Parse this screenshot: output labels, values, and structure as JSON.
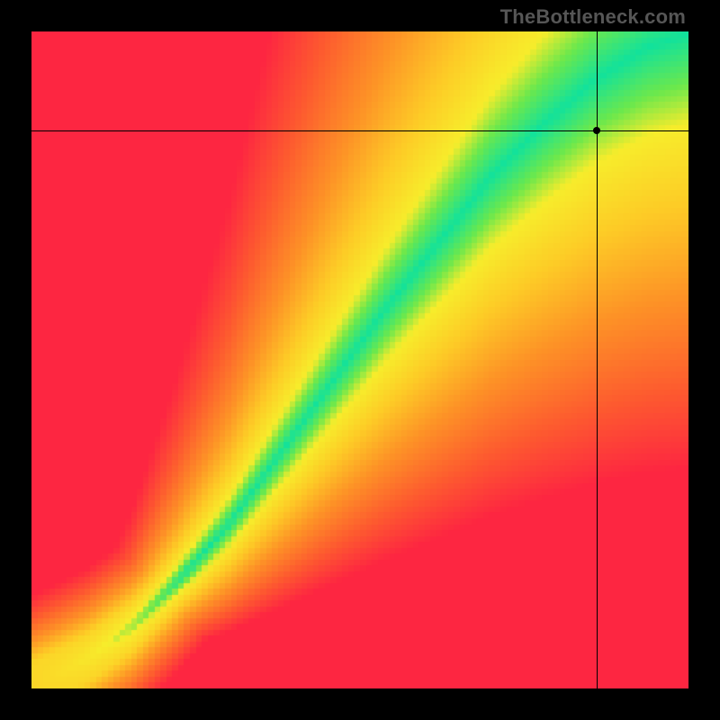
{
  "watermark": "TheBottleneck.com",
  "chart_data": {
    "type": "heatmap",
    "title": "",
    "xlabel": "",
    "ylabel": "",
    "xlim": [
      0,
      100
    ],
    "ylim": [
      0,
      100
    ],
    "grid": false,
    "pixelated": true,
    "color_scale": {
      "description": "Green = balanced, Yellow = minor bottleneck, Orange = moderate bottleneck, Red = severe bottleneck",
      "stops": [
        {
          "deviation": 0.0,
          "color": "#12E29B"
        },
        {
          "deviation": 0.08,
          "color": "#6CE84C"
        },
        {
          "deviation": 0.15,
          "color": "#F7EC2B"
        },
        {
          "deviation": 0.3,
          "color": "#FDCB26"
        },
        {
          "deviation": 0.5,
          "color": "#FD9326"
        },
        {
          "deviation": 0.75,
          "color": "#FD5A2F"
        },
        {
          "deviation": 1.0,
          "color": "#FD2641"
        }
      ]
    },
    "optimal_curve": {
      "description": "y = f(x) along which GPU and CPU are balanced (green ridge). Piecewise-linear control points in [0,100] space.",
      "points": [
        {
          "x": 0,
          "y": 0
        },
        {
          "x": 8,
          "y": 4
        },
        {
          "x": 15,
          "y": 9
        },
        {
          "x": 22,
          "y": 16
        },
        {
          "x": 30,
          "y": 25
        },
        {
          "x": 38,
          "y": 36
        },
        {
          "x": 46,
          "y": 47
        },
        {
          "x": 54,
          "y": 58
        },
        {
          "x": 62,
          "y": 68
        },
        {
          "x": 70,
          "y": 78
        },
        {
          "x": 78,
          "y": 86
        },
        {
          "x": 86,
          "y": 93
        },
        {
          "x": 94,
          "y": 98
        },
        {
          "x": 100,
          "y": 100
        }
      ]
    },
    "marker": {
      "x": 86,
      "y": 85
    },
    "crosshair": {
      "x": 86,
      "y": 85
    }
  }
}
